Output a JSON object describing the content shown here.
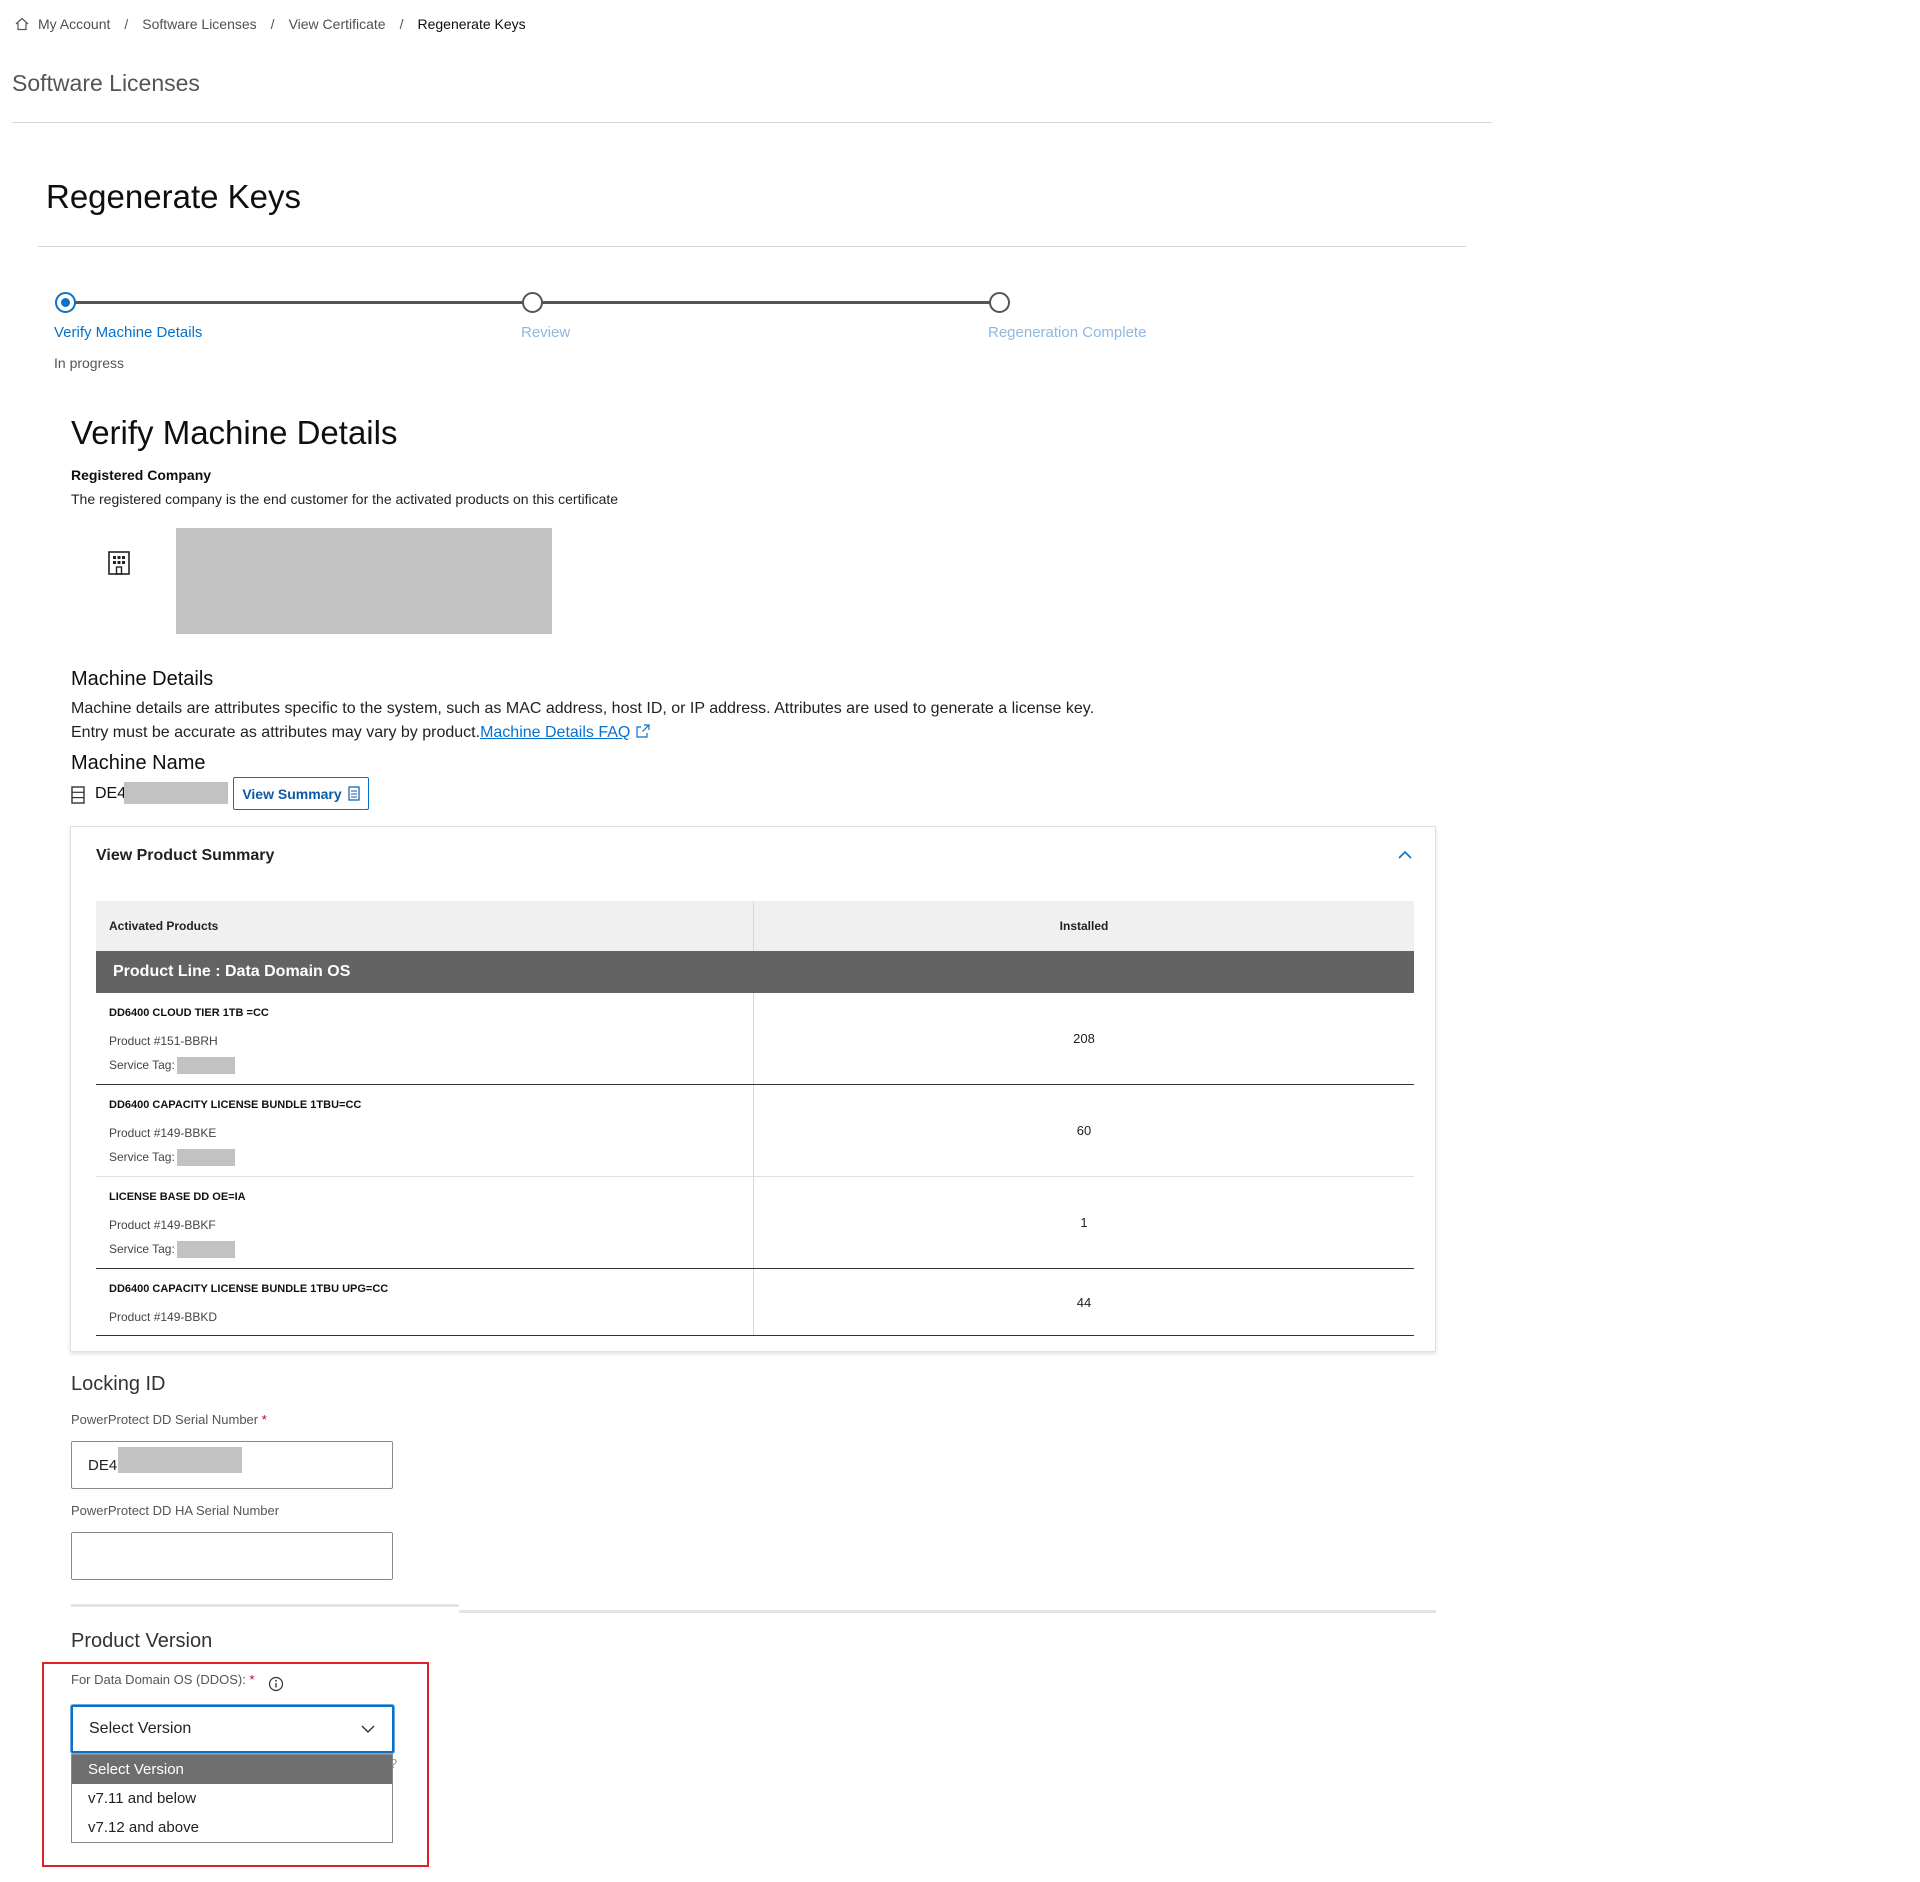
{
  "breadcrumb": {
    "items": [
      "My Account",
      "Software Licenses",
      "View Certificate"
    ],
    "current": "Regenerate Keys"
  },
  "header": {
    "page_title": "Software Licenses"
  },
  "main": {
    "title": "Regenerate Keys",
    "stepper": {
      "steps": [
        {
          "label": "Verify Machine Details",
          "state": "active"
        },
        {
          "label": "Review",
          "state": "pending"
        },
        {
          "label": "Regeneration Complete",
          "state": "pending"
        }
      ],
      "status": "In progress"
    },
    "section_title": "Verify Machine Details",
    "registered_company": {
      "label": "Registered Company",
      "description": "The registered company is the end customer for the activated products on this certificate"
    },
    "machine_details": {
      "title": "Machine Details",
      "description_line1": "Machine details are attributes specific to the system, such as MAC address, host ID, or IP address. Attributes are used to generate a license key.",
      "description_line2": "Entry must be accurate as attributes may vary by product.",
      "faq_link": "Machine Details FAQ"
    },
    "machine_name": {
      "title": "Machine Name",
      "value_prefix": "DE4",
      "view_summary_label": "View Summary"
    },
    "product_summary": {
      "title": "View Product Summary",
      "columns": [
        "Activated Products",
        "Installed"
      ],
      "group": "Product Line : Data Domain OS",
      "rows": [
        {
          "name": "DD6400 CLOUD TIER 1TB =CC",
          "product": "Product #151-BBRH",
          "service_tag": "Service Tag:",
          "installed": "208"
        },
        {
          "name": "DD6400 CAPACITY LICENSE BUNDLE 1TBU=CC",
          "product": "Product #149-BBKE",
          "service_tag": "Service Tag:",
          "installed": "60"
        },
        {
          "name": "LICENSE BASE DD OE=IA",
          "product": "Product #149-BBKF",
          "service_tag": "Service Tag:",
          "installed": "1"
        },
        {
          "name": "DD6400 CAPACITY LICENSE BUNDLE 1TBU UPG=CC",
          "product": "Product #149-BBKD",
          "installed": "44"
        }
      ]
    },
    "locking_id": {
      "title": "Locking ID",
      "serial_label": "PowerProtect DD Serial Number",
      "serial_value": "DE4",
      "ha_serial_label": "PowerProtect DD HA Serial Number",
      "ha_serial_value": "",
      "required_mark": "*"
    },
    "product_version": {
      "title": "Product Version",
      "ddos_label": "For Data Domain OS (DDOS):",
      "required_mark": "*",
      "selected": "Select Version",
      "hidden_text_fragment": "?",
      "options": [
        "Select Version",
        "v7.11 and below",
        "v7.12 and above"
      ]
    }
  },
  "colors": {
    "accent": "#0672cb",
    "group_header": "#636363",
    "highlight": "#e0202a",
    "required": "#c4001a"
  }
}
